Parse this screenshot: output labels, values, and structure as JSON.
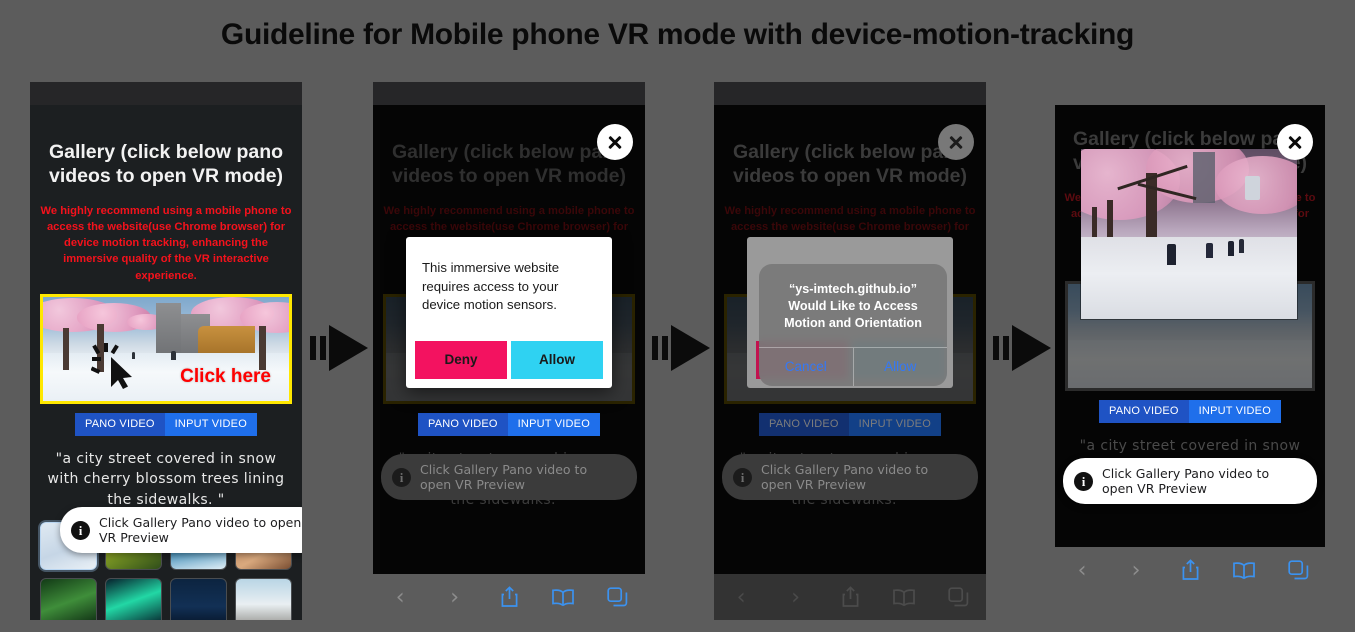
{
  "title": "Guideline for Mobile phone VR mode with device-motion-tracking",
  "colors": {
    "page_background": "#5c5c5c",
    "phone_background": "#1c1f21",
    "warning_red": "#f5121c",
    "highlight_yellow": "#ffe800",
    "pano_button_blue": "#1f53c4",
    "input_button_blue": "#1f6feb",
    "deny_pink": "#f31260",
    "allow_cyan": "#2fd2f2",
    "ios_link_blue": "#3478f6"
  },
  "app": {
    "gallery_heading": "Gallery (click below pano videos to open VR mode)",
    "warning_text": "We highly recommend using a mobile phone to access the website(use Chrome browser) for device motion tracking, enhancing the immersive quality of the VR interactive experience.",
    "click_here_label": "Click here",
    "pano_video_label": "PANO VIDEO",
    "input_video_label": "INPUT VIDEO",
    "caption": "\"a city street covered in snow with cherry blossom trees lining the sidewalks. \"",
    "toast_text": "Click Gallery Pano video to open VR Preview",
    "toast_icon": "info-icon",
    "close_icon": "close-icon"
  },
  "panels": [
    {
      "id": "panel-1",
      "name": "gallery-landing",
      "state": "initial"
    },
    {
      "id": "panel-2",
      "name": "chrome-motion-permission",
      "state": "dialog-open"
    },
    {
      "id": "panel-3",
      "name": "ios-motion-permission",
      "state": "dialog-open"
    },
    {
      "id": "panel-4",
      "name": "vr-preview-open",
      "state": "preview"
    }
  ],
  "chrome_dialog": {
    "message": "This immersive website requires access to your device motion sensors.",
    "deny_label": "Deny",
    "allow_label": "Allow"
  },
  "ios_dialog": {
    "message": "“ys-imtech.github.io” Would Like to Access Motion and Orientation",
    "cancel_label": "Cancel",
    "allow_label": "Allow"
  },
  "browser_toolbar": {
    "back_icon": "chevron-left-icon",
    "forward_icon": "chevron-right-icon",
    "share_icon": "share-icon",
    "bookmarks_icon": "book-icon",
    "tabs_icon": "tabs-icon",
    "back_label": "‹",
    "forward_label": "›"
  },
  "arrows": [
    {
      "name": "flow-arrow-1"
    },
    {
      "name": "flow-arrow-2"
    },
    {
      "name": "flow-arrow-3"
    }
  ]
}
